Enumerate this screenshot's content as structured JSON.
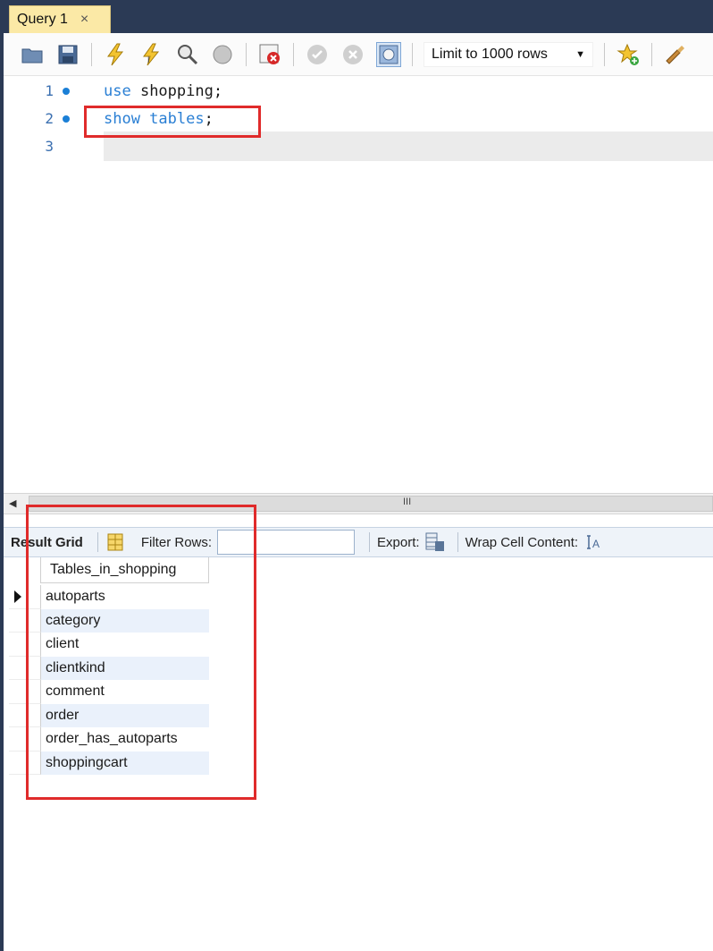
{
  "tab": {
    "label": "Query 1",
    "close_glyph": "×"
  },
  "toolbar": {
    "limit_label": "Limit to 1000 rows",
    "buttons": [
      "open-folder-icon",
      "save-icon",
      "execute-icon",
      "execute-current-icon",
      "explain-icon",
      "stop-icon",
      "toggle-error-icon",
      "commit-icon",
      "rollback-icon",
      "autocommit-icon",
      "favorites-icon",
      "beautify-icon"
    ]
  },
  "editor": {
    "lines": [
      {
        "num": "1",
        "keyword": "use",
        "rest": " shopping;"
      },
      {
        "num": "2",
        "keyword": "show tables",
        "rest": ";"
      },
      {
        "num": "3",
        "keyword": "",
        "rest": ""
      }
    ]
  },
  "scroll": {
    "grip": "III",
    "left_arrow": "◀"
  },
  "result_toolbar": {
    "result_grid": "Result Grid",
    "filter_rows": "Filter Rows:",
    "filter_value": "",
    "export": "Export:",
    "wrap": "Wrap Cell Content:"
  },
  "grid": {
    "column": "Tables_in_shopping",
    "rows": [
      "autoparts",
      "category",
      "client",
      "clientkind",
      "comment",
      "order",
      "order_has_autoparts",
      "shoppingcart"
    ]
  },
  "colors": {
    "frame": "#2b3a55",
    "tab": "#fbe9a6",
    "keyword": "#2a7fd4",
    "highlight": "#e02b2b",
    "alt_row": "#eaf1fb"
  }
}
